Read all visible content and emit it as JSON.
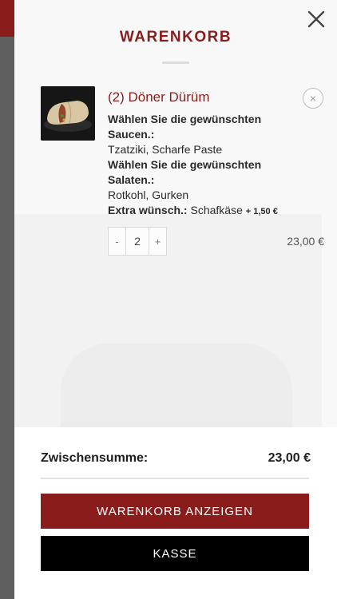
{
  "cart": {
    "title": "WARENKORB",
    "items": [
      {
        "name": "(2) Döner Dürüm",
        "options": [
          {
            "label": "Wählen Sie die gewünschten Saucen.:",
            "label_line1": "Wählen Sie die gewünschten",
            "label_line2": "Saucen.:",
            "value": "Tzatziki, Scharfe Paste"
          },
          {
            "label": "Wählen Sie die gewünschten Salaten.:",
            "label_line1": "Wählen Sie die gewünschten",
            "label_line2": "Salaten.:",
            "value": "Rotkohl, Gurken"
          },
          {
            "label": "Extra wünsch.:",
            "value": "Schafkäse",
            "surcharge": "+ 1,50 €"
          }
        ],
        "quantity": "2",
        "minus": "-",
        "plus": "+",
        "line_total": "23,00 €"
      }
    ]
  },
  "footer": {
    "subtotal_label": "Zwischensumme:",
    "subtotal_value": "23,00 €",
    "view_cart_label": "WARENKORB ANZEIGEN",
    "checkout_label": "KASSE"
  },
  "colors": {
    "brand": "#8b1c1c",
    "checkout": "#000000"
  },
  "icons": {
    "close": "close-icon",
    "remove": "remove-item-icon"
  }
}
